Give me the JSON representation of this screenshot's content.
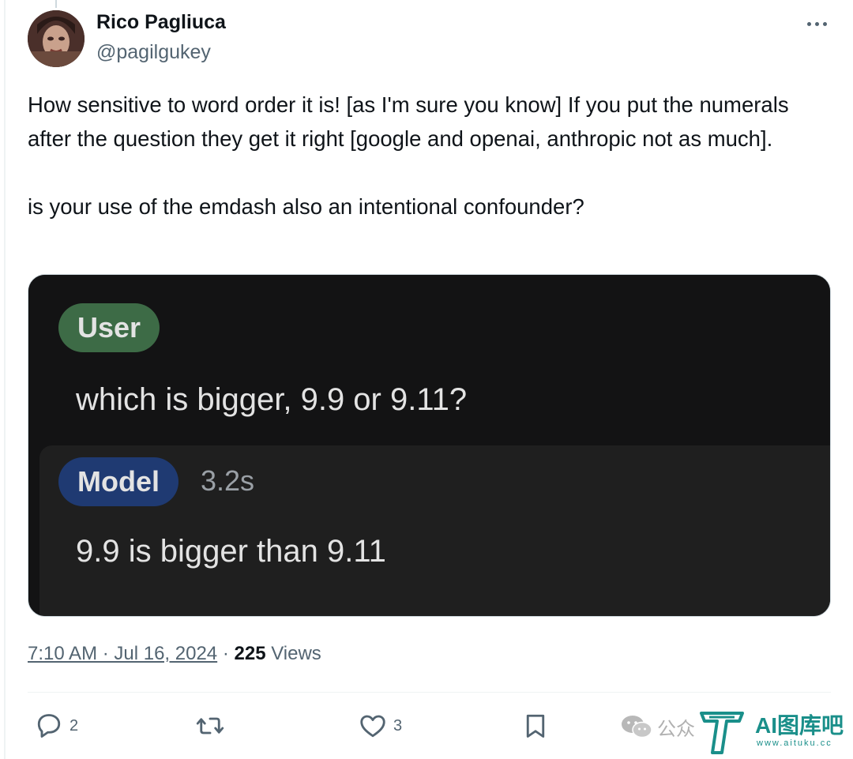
{
  "author": {
    "name": "Rico Pagliuca",
    "handle": "@pagilgukey"
  },
  "tweet": {
    "text": "How sensitive to word order it is! [as I'm sure you know] If you put the numerals after the question they get it right [google and openai, anthropic not as much].\n\nis your use of the emdash also an intentional confounder?"
  },
  "media": {
    "user_label": "User",
    "prompt": "which is bigger, 9.9 or 9.11?",
    "model_label": "Model",
    "timing": "3.2s",
    "answer": "9.9 is bigger than 9.11",
    "colors": {
      "user_pill": "#3d6b46",
      "model_pill": "#1f3a72",
      "background": "#131314"
    }
  },
  "meta": {
    "timestamp": "7:10 AM · Jul 16, 2024",
    "separator": "·",
    "views_count": "225",
    "views_label": "Views"
  },
  "actions": {
    "reply_icon": "reply-icon",
    "reply_count": "2",
    "repost_icon": "repost-icon",
    "like_icon": "heart-icon",
    "like_count": "3",
    "bookmark_icon": "bookmark-icon"
  },
  "watermark": {
    "partial_text": "公众",
    "brand": "AI图库吧",
    "url": "www.aituku.cc"
  }
}
